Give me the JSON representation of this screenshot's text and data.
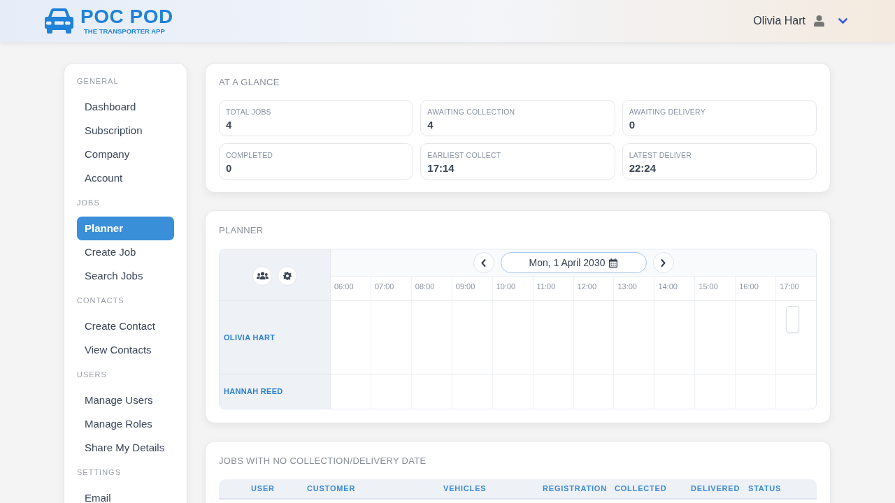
{
  "header": {
    "logo": {
      "title": "POC POD",
      "subtitle": "THE TRANSPORTER APP"
    },
    "user": {
      "name": "Olivia Hart"
    }
  },
  "sidebar": {
    "sections": [
      {
        "title": "GENERAL",
        "items": [
          {
            "label": "Dashboard",
            "selected": false
          },
          {
            "label": "Subscription",
            "selected": false
          },
          {
            "label": "Company",
            "selected": false
          },
          {
            "label": "Account",
            "selected": false
          }
        ]
      },
      {
        "title": "JOBS",
        "items": [
          {
            "label": "Planner",
            "selected": true
          },
          {
            "label": "Create Job",
            "selected": false
          },
          {
            "label": "Search Jobs",
            "selected": false
          }
        ]
      },
      {
        "title": "CONTACTS",
        "items": [
          {
            "label": "Create Contact",
            "selected": false
          },
          {
            "label": "View Contacts",
            "selected": false
          }
        ]
      },
      {
        "title": "USERS",
        "items": [
          {
            "label": "Manage Users",
            "selected": false
          },
          {
            "label": "Manage Roles",
            "selected": false
          },
          {
            "label": "Share My Details",
            "selected": false
          }
        ]
      },
      {
        "title": "SETTINGS",
        "items": [
          {
            "label": "Email",
            "selected": false
          }
        ]
      }
    ]
  },
  "glance": {
    "title": "AT A GLANCE",
    "stats": [
      {
        "label": "TOTAL JOBS",
        "value": "4"
      },
      {
        "label": "AWAITING COLLECTION",
        "value": "4"
      },
      {
        "label": "AWAITING DELIVERY",
        "value": "0"
      },
      {
        "label": "COMPLETED",
        "value": "0"
      },
      {
        "label": "EARLIEST COLLECT",
        "value": "17:14"
      },
      {
        "label": "LATEST DELIVER",
        "value": "22:24"
      }
    ]
  },
  "planner": {
    "title": "PLANNER",
    "date": "Mon, 1 April 2030",
    "hours": [
      "06:00",
      "07:00",
      "08:00",
      "09:00",
      "10:00",
      "11:00",
      "12:00",
      "13:00",
      "14:00",
      "15:00",
      "16:00",
      "17:00"
    ],
    "rows": [
      {
        "name": "OLIVIA HART",
        "jobs": [
          {
            "kind": "job"
          }
        ]
      },
      {
        "name": "HANNAH REED",
        "jobs": []
      }
    ]
  },
  "unscheduled_jobs": {
    "title": "JOBS WITH NO COLLECTION/DELIVERY DATE",
    "columns": [
      "USER",
      "CUSTOMER",
      "VEHICLES",
      "REGISTRATION",
      "COLLECTED",
      "DELIVERED",
      "STATUS"
    ]
  }
}
